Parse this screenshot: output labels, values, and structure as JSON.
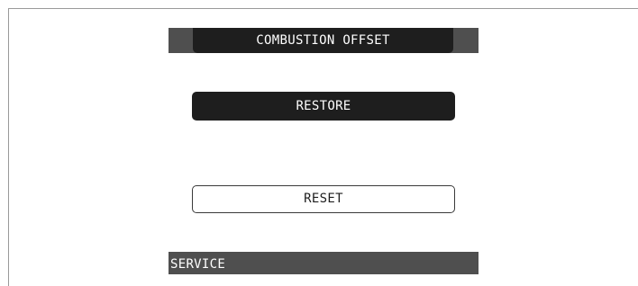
{
  "screen": {
    "title": "COMBUSTION OFFSET",
    "buttons": {
      "restore_label": "RESTORE",
      "reset_label": "RESET"
    },
    "status": "SERVICE"
  },
  "colors": {
    "bar": "#4f4f4f",
    "dark": "#1e1e1e",
    "text_light": "#ffffff"
  }
}
